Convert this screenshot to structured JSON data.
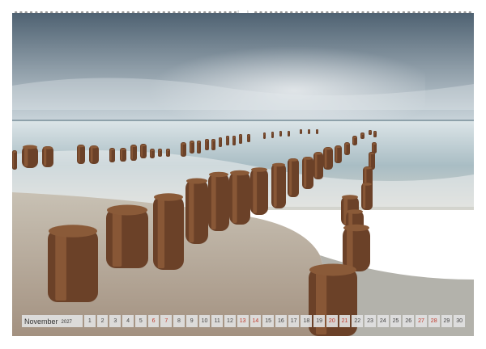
{
  "calendar": {
    "month": "November",
    "year": "2027",
    "holiday_color": "#c0392b",
    "days": [
      {
        "label": "1"
      },
      {
        "label": "2"
      },
      {
        "label": "3"
      },
      {
        "label": "4"
      },
      {
        "label": "5"
      },
      {
        "label": "6",
        "holiday": true
      },
      {
        "label": "7",
        "holiday": true
      },
      {
        "label": "8"
      },
      {
        "label": "9"
      },
      {
        "label": "10"
      },
      {
        "label": "11"
      },
      {
        "label": "12"
      },
      {
        "label": "13",
        "holiday": true
      },
      {
        "label": "14",
        "holiday": true
      },
      {
        "label": "15"
      },
      {
        "label": "16"
      },
      {
        "label": "17"
      },
      {
        "label": "18"
      },
      {
        "label": "19"
      },
      {
        "label": "20",
        "holiday": true
      },
      {
        "label": "21",
        "holiday": true
      },
      {
        "label": "22"
      },
      {
        "label": "23"
      },
      {
        "label": "24"
      },
      {
        "label": "25"
      },
      {
        "label": "26"
      },
      {
        "label": "27",
        "holiday": true
      },
      {
        "label": "28",
        "holiday": true
      },
      {
        "label": "29"
      },
      {
        "label": "30"
      }
    ]
  },
  "photo": {
    "subject": "wooden groynes on a misty beach",
    "colors": {
      "sky_top": "#4f6272",
      "sky_bottom": "#c9d4da",
      "sea": "#a9bdc4",
      "sand": "#a39180",
      "wood": "#6b4128"
    }
  }
}
